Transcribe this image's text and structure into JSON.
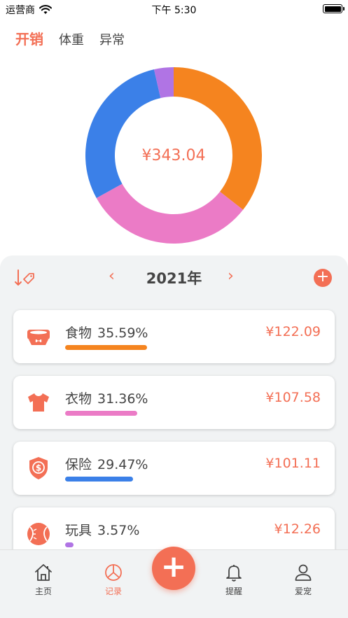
{
  "status_bar": {
    "carrier": "运营商",
    "time": "下午 5:30"
  },
  "top_tabs": [
    {
      "label": "开销",
      "active": true
    },
    {
      "label": "体重",
      "active": false
    },
    {
      "label": "异常",
      "active": false
    }
  ],
  "summary": {
    "total": "¥343.04"
  },
  "chart_data": {
    "type": "pie",
    "categories": [
      "食物",
      "衣物",
      "保险",
      "玩具"
    ],
    "values": [
      35.59,
      31.36,
      29.47,
      3.57
    ],
    "colors": [
      "#f5841f",
      "#eb7bc6",
      "#3b80e8",
      "#b074e4"
    ]
  },
  "year_nav": {
    "prev": "‹",
    "year": "2021年",
    "next": "›",
    "add": "+"
  },
  "categories": [
    {
      "name": "食物",
      "percent": "35.59%",
      "amount": "¥122.09",
      "fraction": 0.3559,
      "color": "#f5841f",
      "icon": "pet-bowl-icon"
    },
    {
      "name": "衣物",
      "percent": "31.36%",
      "amount": "¥107.58",
      "fraction": 0.3136,
      "color": "#eb7bc6",
      "icon": "shirt-icon"
    },
    {
      "name": "保险",
      "percent": "29.47%",
      "amount": "¥101.11",
      "fraction": 0.2947,
      "color": "#3b80e8",
      "icon": "shield-dollar-icon"
    },
    {
      "name": "玩具",
      "percent": "3.57%",
      "amount": "¥12.26",
      "fraction": 0.0357,
      "color": "#b074e4",
      "icon": "ball-icon"
    }
  ],
  "tab_bar": [
    {
      "label": "主页",
      "icon": "home-icon",
      "active": false
    },
    {
      "label": "记录",
      "icon": "pie-chart-icon",
      "active": true
    },
    {
      "label": "提醒",
      "icon": "bell-icon",
      "active": false
    },
    {
      "label": "爱宠",
      "icon": "user-icon",
      "active": false
    }
  ],
  "fab": {
    "label": "+"
  },
  "colors": {
    "accent": "#f36f55",
    "panel_bg": "#f1f3f4"
  }
}
